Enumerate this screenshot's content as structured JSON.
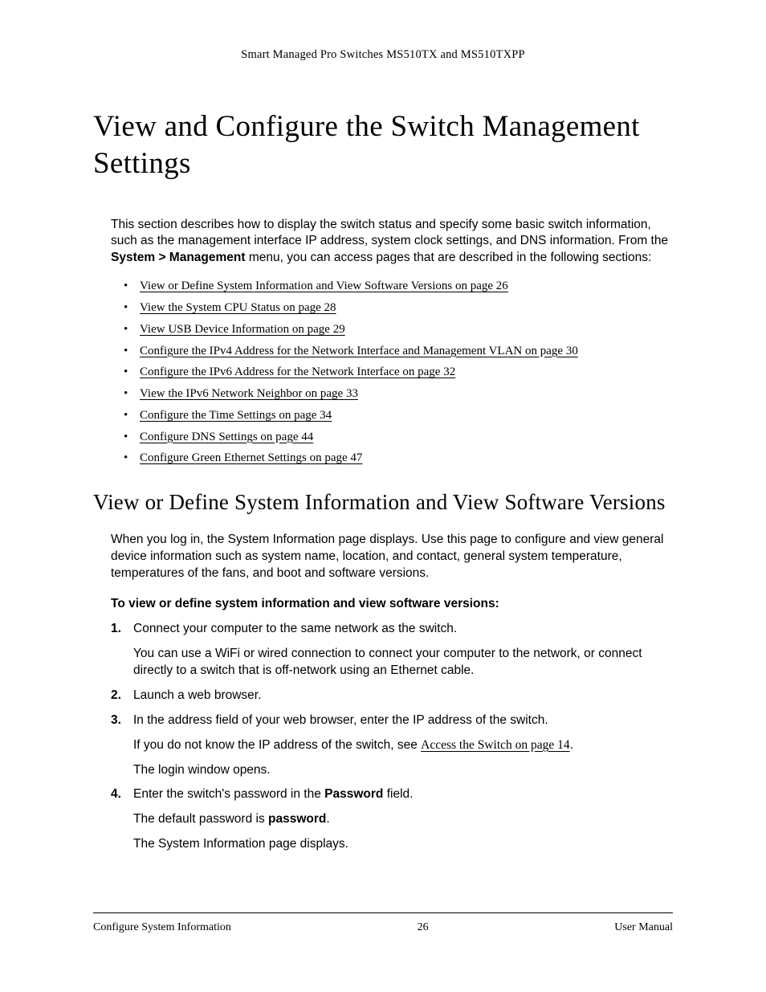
{
  "header": {
    "running": "Smart Managed Pro Switches MS510TX and MS510TXPP"
  },
  "title": "View and Configure the Switch Management Settings",
  "intro": {
    "p1a": "This section describes how to display the switch status and specify some basic switch information, such as the management interface IP address, system clock settings, and DNS information. From the ",
    "bold": "System > Management",
    "p1b": " menu, you can access pages that are described in the following sections:"
  },
  "links": [
    "View or Define System Information and View Software Versions on page 26",
    "View the System CPU Status on page 28",
    "View USB Device Information on page 29",
    "Configure the IPv4 Address for the Network Interface and Management VLAN on page 30",
    "Configure the IPv6 Address for the Network Interface on page 32",
    "View the IPv6 Network Neighbor on page 33",
    "Configure the Time Settings on page 34",
    "Configure DNS Settings on page 44",
    "Configure Green Ethernet Settings on page 47"
  ],
  "subheading": "View or Define System Information and View Software Versions",
  "subpara": "When you log in, the System Information page displays. Use this page to configure and view general device information such as system name, location, and contact, general system temperature, temperatures of the fans, and boot and software versions.",
  "procedure_title": "To view or define system information and view software versions:",
  "steps": {
    "s1": "Connect your computer to the same network as the switch.",
    "s1sub": "You can use a WiFi or wired connection to connect your computer to the network, or connect directly to a switch that is off-network using an Ethernet cable.",
    "s2": "Launch a web browser.",
    "s3": "In the address field of your web browser, enter the IP address of the switch.",
    "s3sub_a": "If you do not know the IP address of the switch, see ",
    "s3sub_link": "Access the Switch on page 14",
    "s3sub_b": ".",
    "s3sub2": "The login window opens.",
    "s4a": "Enter the switch's password in the ",
    "s4bold": "Password",
    "s4b": " field.",
    "s4sub_a": "The default password is ",
    "s4sub_bold": "password",
    "s4sub_b": ".",
    "s4sub2": "The System Information page displays."
  },
  "footer": {
    "left": "Configure System Information",
    "center": "26",
    "right": "User Manual"
  }
}
